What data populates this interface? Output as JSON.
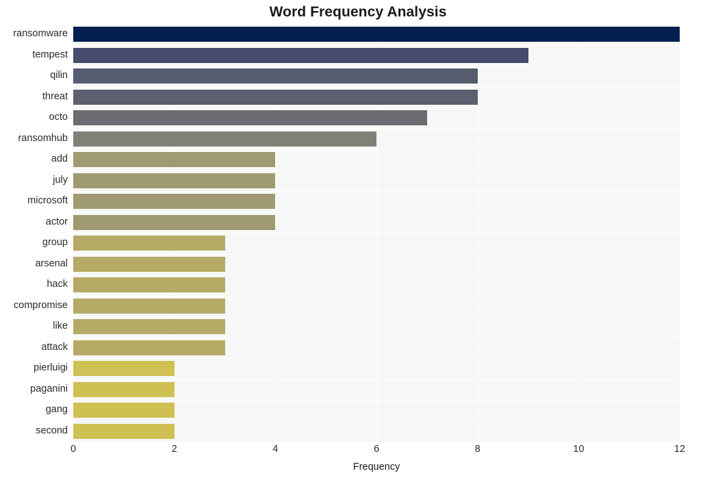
{
  "chart_data": {
    "type": "bar",
    "orientation": "horizontal",
    "title": "Word Frequency Analysis",
    "xlabel": "Frequency",
    "ylabel": "",
    "categories": [
      "ransomware",
      "tempest",
      "qilin",
      "threat",
      "octo",
      "ransomhub",
      "add",
      "july",
      "microsoft",
      "actor",
      "group",
      "arsenal",
      "hack",
      "compromise",
      "like",
      "attack",
      "pierluigi",
      "paganini",
      "gang",
      "second"
    ],
    "values": [
      12,
      9,
      8,
      8,
      7,
      6,
      4,
      4,
      4,
      4,
      3,
      3,
      3,
      3,
      3,
      3,
      2,
      2,
      2,
      2
    ],
    "bar_colors": [
      "#042050",
      "#454c6d",
      "#575c6f",
      "#5c6070",
      "#6b6c71",
      "#808076",
      "#a09a70",
      "#a09a70",
      "#a09a70",
      "#a09a70",
      "#b5ab66",
      "#b5ab66",
      "#b5ab66",
      "#b5ab66",
      "#b5ab66",
      "#b5ab66",
      "#cfc054",
      "#cfc054",
      "#cfc054",
      "#cfc054"
    ],
    "xlim": [
      0,
      12.0
    ],
    "xticks": [
      0,
      2,
      4,
      6,
      8,
      10,
      12
    ],
    "xticklabels": [
      "0",
      "2",
      "4",
      "6",
      "8",
      "10",
      "12"
    ],
    "grid": true,
    "grid_axis": "x",
    "grid_color": "#ffffff",
    "plot_background": "#f7f7f7",
    "figure_background": "#ffffff",
    "legend": null
  }
}
